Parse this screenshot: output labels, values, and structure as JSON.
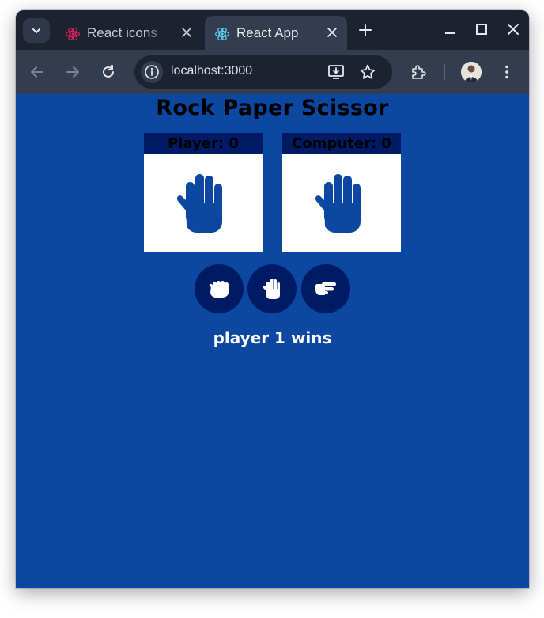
{
  "browser": {
    "tabs": [
      {
        "title": "React icons",
        "icon": "react-icon-pink",
        "active": false
      },
      {
        "title": "React App",
        "icon": "react-icon-cyan",
        "active": true
      }
    ],
    "address": "localhost:3000"
  },
  "app": {
    "title": "Rock Paper Scissor",
    "player_label": "Player: 0",
    "computer_label": "Computer: 0",
    "player_choice": "paper-hand-icon",
    "computer_choice": "paper-hand-icon",
    "choices": [
      "rock",
      "paper",
      "scissors"
    ],
    "result": "player 1 wins"
  },
  "colors": {
    "background": "#0c47a1",
    "card_header": "#001a66",
    "button": "#001b66",
    "hand": "#0c47a1",
    "text_dark": "#000000",
    "text_light": "#ffffff"
  }
}
